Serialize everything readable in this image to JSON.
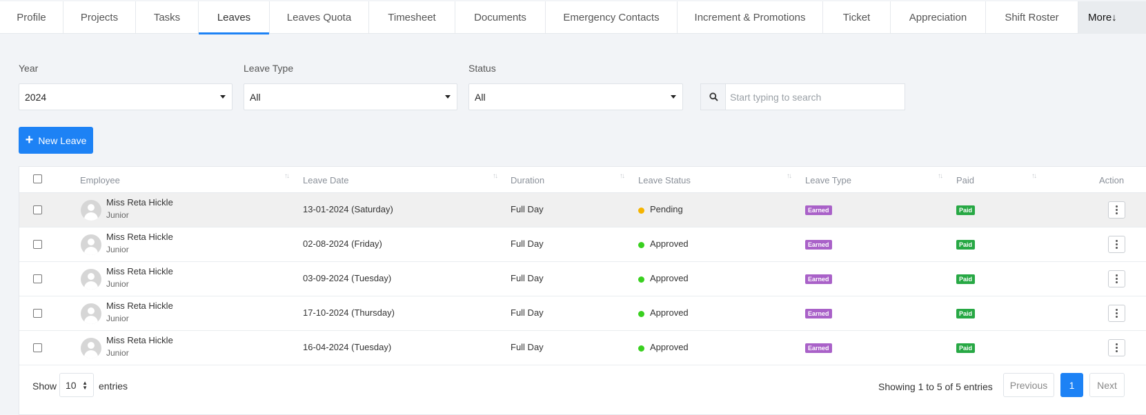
{
  "tabs": [
    {
      "label": "Profile"
    },
    {
      "label": "Projects"
    },
    {
      "label": "Tasks"
    },
    {
      "label": "Leaves"
    },
    {
      "label": "Leaves Quota"
    },
    {
      "label": "Timesheet"
    },
    {
      "label": "Documents"
    },
    {
      "label": "Emergency Contacts"
    },
    {
      "label": "Increment & Promotions"
    },
    {
      "label": "Ticket"
    },
    {
      "label": "Appreciation"
    },
    {
      "label": "Shift Roster"
    },
    {
      "label": "More↓"
    }
  ],
  "active_tab": "Leaves",
  "filters": {
    "year": {
      "label": "Year",
      "value": "2024"
    },
    "leave_type": {
      "label": "Leave Type",
      "value": "All"
    },
    "status": {
      "label": "Status",
      "value": "All"
    },
    "search": {
      "placeholder": "Start typing to search"
    }
  },
  "new_leave_label": "New Leave",
  "table": {
    "columns": [
      "Employee",
      "Leave Date",
      "Duration",
      "Leave Status",
      "Leave Type",
      "Paid",
      "Action"
    ],
    "rows": [
      {
        "name": "Miss Reta Hickle",
        "designation": "Junior",
        "date": "13-01-2024 (Saturday)",
        "duration": "Full Day",
        "status": "Pending",
        "type": "Earned",
        "paid": "Paid"
      },
      {
        "name": "Miss Reta Hickle",
        "designation": "Junior",
        "date": "02-08-2024 (Friday)",
        "duration": "Full Day",
        "status": "Approved",
        "type": "Earned",
        "paid": "Paid"
      },
      {
        "name": "Miss Reta Hickle",
        "designation": "Junior",
        "date": "03-09-2024 (Tuesday)",
        "duration": "Full Day",
        "status": "Approved",
        "type": "Earned",
        "paid": "Paid"
      },
      {
        "name": "Miss Reta Hickle",
        "designation": "Junior",
        "date": "17-10-2024 (Thursday)",
        "duration": "Full Day",
        "status": "Approved",
        "type": "Earned",
        "paid": "Paid"
      },
      {
        "name": "Miss Reta Hickle",
        "designation": "Junior",
        "date": "16-04-2024 (Tuesday)",
        "duration": "Full Day",
        "status": "Approved",
        "type": "Earned",
        "paid": "Paid"
      }
    ]
  },
  "footer": {
    "show": "Show",
    "page_length": "10",
    "entries": "entries",
    "info": "Showing 1 to 5 of 5 entries",
    "previous": "Previous",
    "current_page": "1",
    "next": "Next"
  },
  "colors": {
    "accent": "#1d82f5",
    "pending": "#f5b400",
    "approved": "#39d01f",
    "earned_badge": "#a961c8",
    "paid_badge": "#27a844"
  }
}
